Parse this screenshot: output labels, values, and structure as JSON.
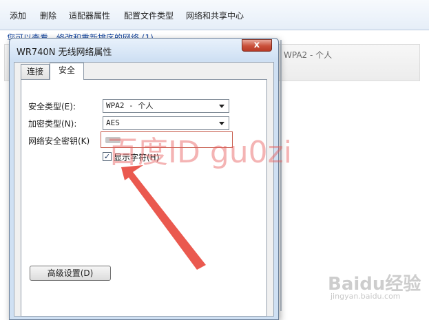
{
  "toolbar": {
    "items": [
      "添加",
      "删除",
      "适配器属性",
      "配置文件类型",
      "网络和共享中心"
    ]
  },
  "subline": "您可以查看、修改和重新排序的网络 (1)",
  "background_list": {
    "security_value": "WPA2 - 个人"
  },
  "dialog": {
    "title": "WR740N 无线网络属性",
    "close_glyph": "x",
    "tabs": [
      {
        "label": "连接",
        "active": false
      },
      {
        "label": "安全",
        "active": true
      }
    ],
    "security_type": {
      "label": "安全类型(E):",
      "value": "WPA2 - 个人"
    },
    "encryption_type": {
      "label": "加密类型(N):",
      "value": "AES"
    },
    "network_key": {
      "label": "网络安全密钥(K)"
    },
    "show_characters": {
      "label": "显示字符(H)",
      "checked": true
    },
    "advanced_button": "高级设置(D)"
  },
  "watermark": "百度ID gu0zi",
  "annotation": {
    "color": "#e8473c",
    "icon": "arrow-pointing-to-checkbox"
  },
  "baidu": {
    "logo": "Baidu经验",
    "url": "jingyan.baidu.com"
  }
}
